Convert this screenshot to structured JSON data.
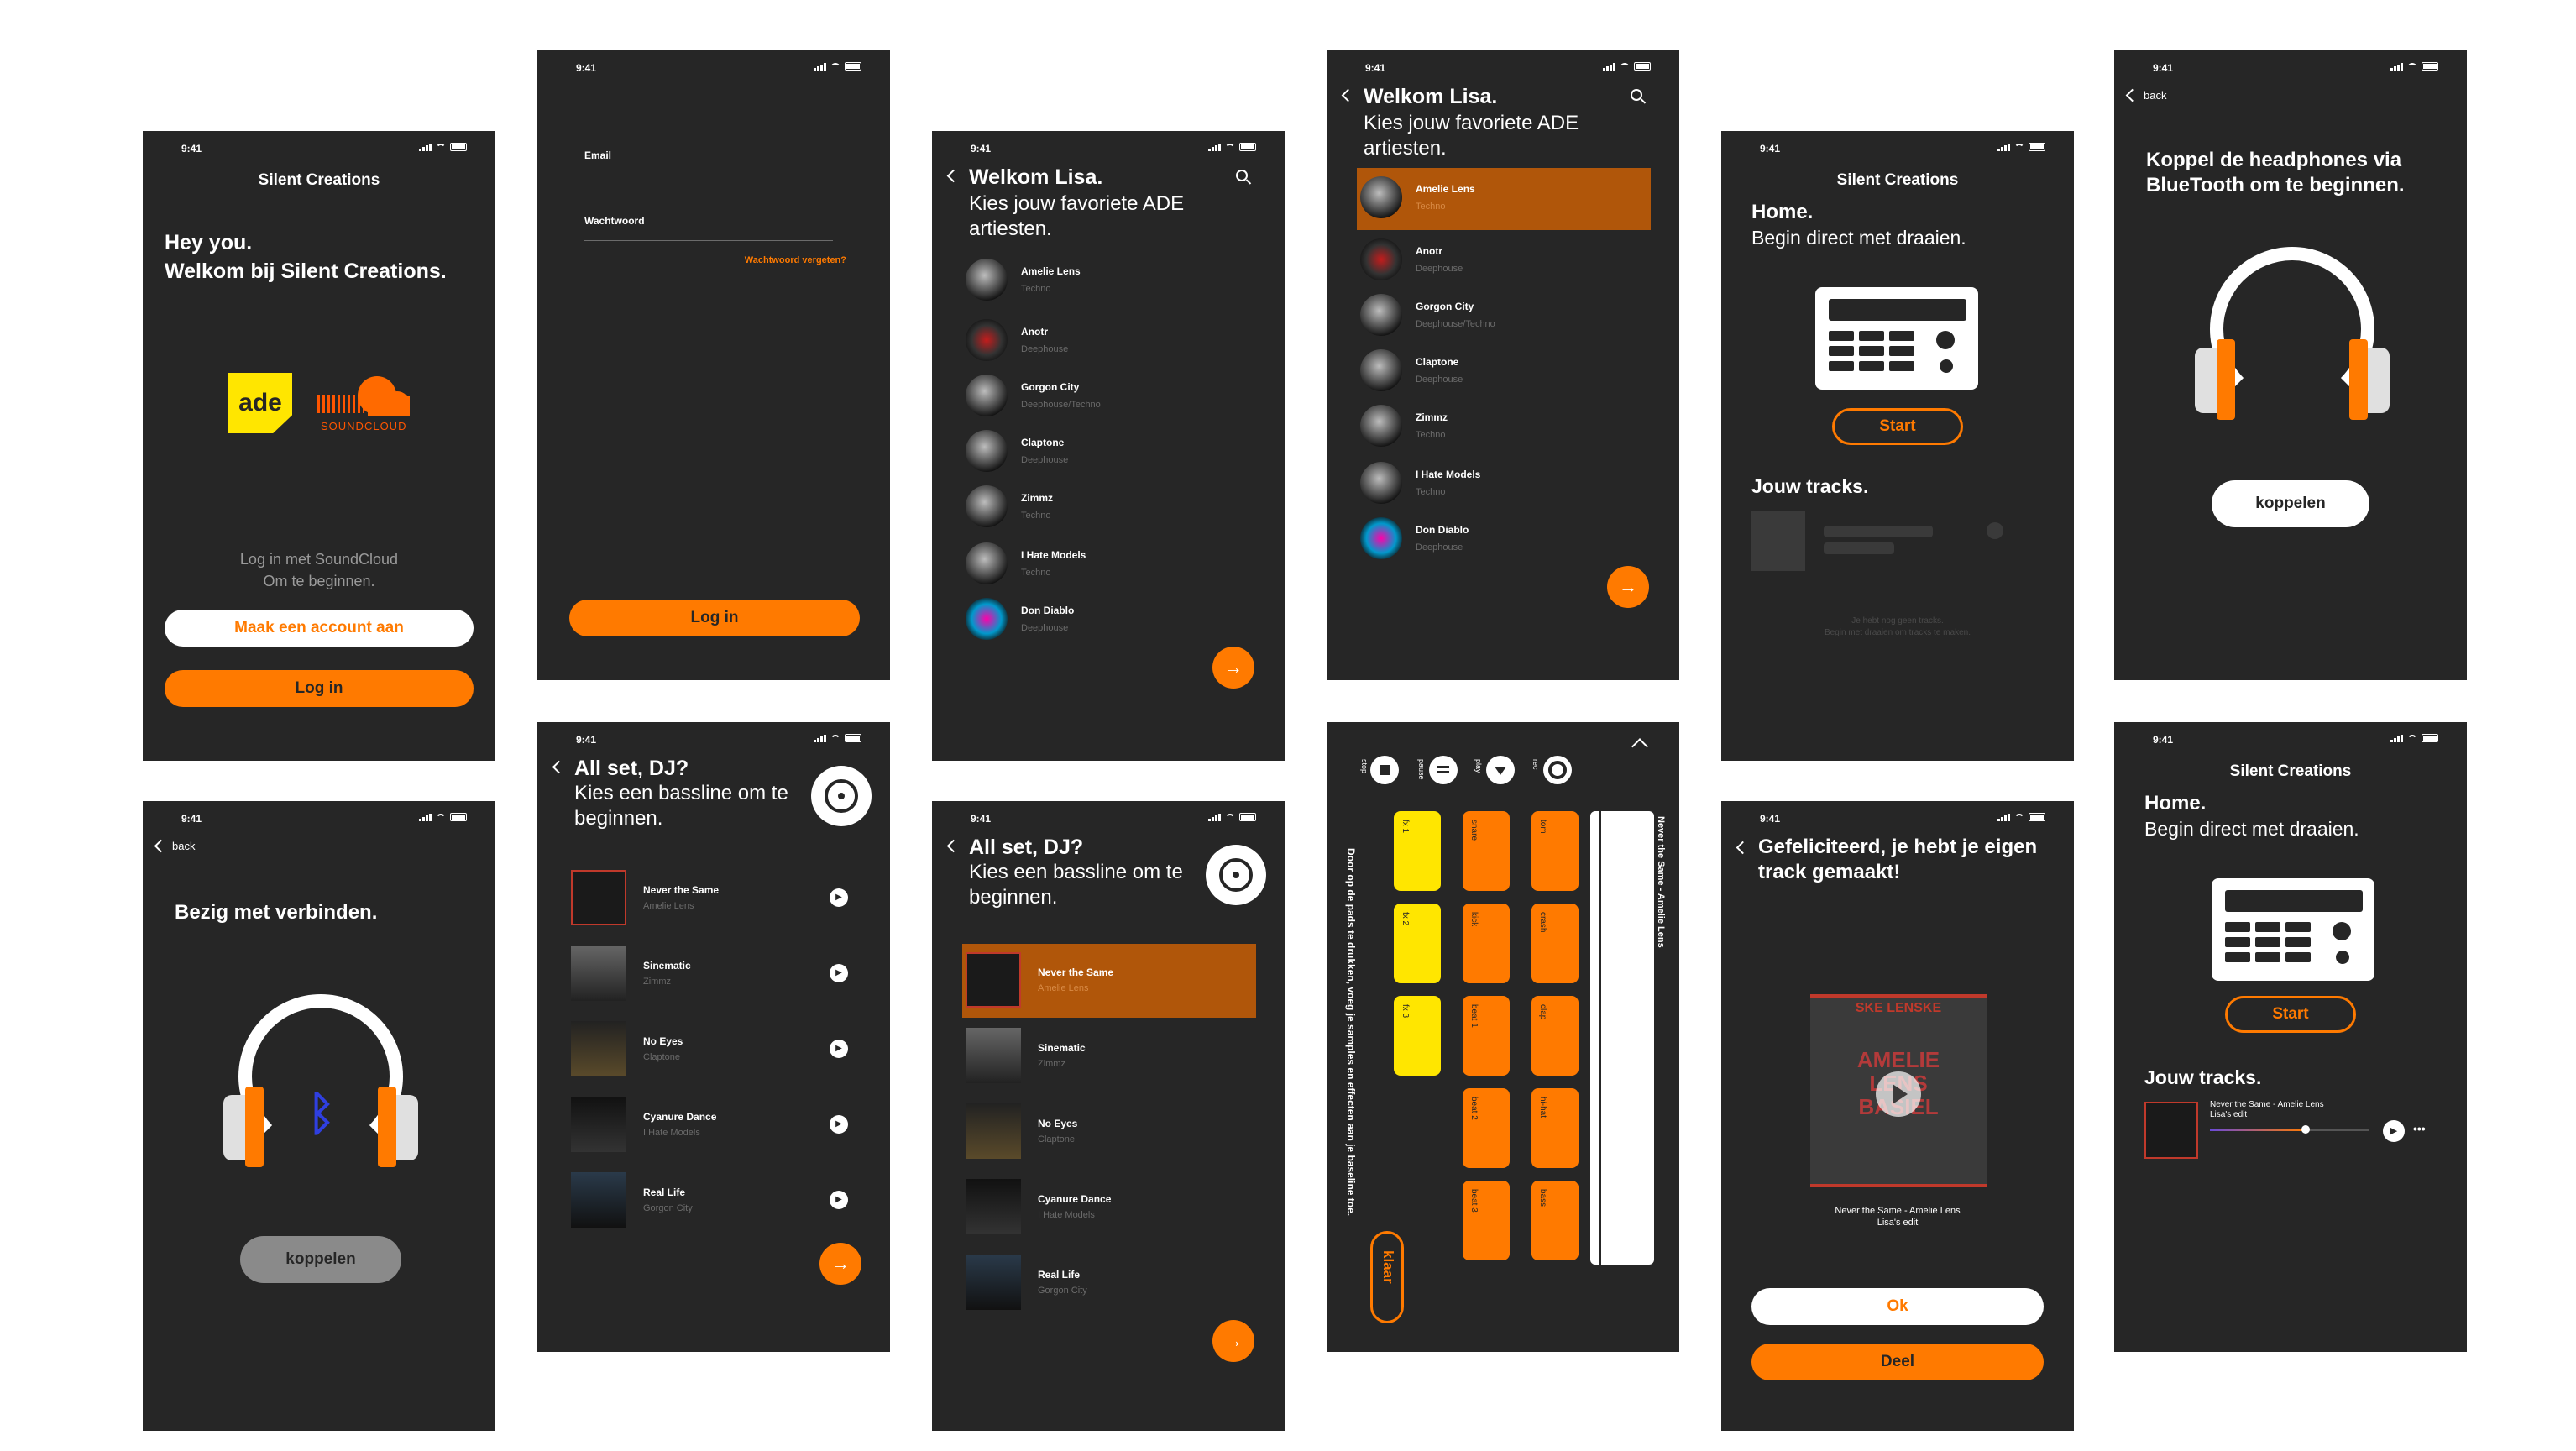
{
  "status_time": "9:41",
  "colors": {
    "accent": "#ff7a00",
    "screen_bg": "#262626",
    "pad_yellow": "#ffe600",
    "muted": "#6b6b6b"
  },
  "s1": {
    "app_title": "Silent Creations",
    "greeting": "Hey you.",
    "welcome": "Welkom bij Silent Creations.",
    "ade_logo": "ade",
    "soundcloud_logo": "SOUNDCLOUD",
    "login_hint_1": "Log in met SoundCloud",
    "login_hint_2": "Om te beginnen.",
    "create_account": "Maak een account aan",
    "login": "Log in"
  },
  "s2": {
    "email_label": "Email",
    "password_label": "Wachtwoord",
    "forgot": "Wachtwoord vergeten?",
    "login": "Log in"
  },
  "artists_screen": {
    "title": "Welkom Lisa.",
    "subtitle": "Kies jouw favoriete ADE artiesten.",
    "next_icon": "arrow-right-icon"
  },
  "artists": [
    {
      "name": "Amelie Lens",
      "genre": "Techno"
    },
    {
      "name": "Anotr",
      "genre": "Deephouse"
    },
    {
      "name": "Gorgon City",
      "genre": "Deephouse/Techno"
    },
    {
      "name": "Claptone",
      "genre": "Deephouse"
    },
    {
      "name": "Zimmz",
      "genre": "Techno"
    },
    {
      "name": "I Hate Models",
      "genre": "Techno"
    },
    {
      "name": "Don Diablo",
      "genre": "Deephouse"
    }
  ],
  "home": {
    "app_title": "Silent Creations",
    "title": "Home.",
    "subtitle": "Begin direct met draaien.",
    "start": "Start",
    "tracks_title": "Jouw tracks.",
    "empty_1": "Je hebt nog geen tracks.",
    "empty_2": "Begin met draaien om tracks te maken."
  },
  "pair": {
    "back": "back",
    "title": "Koppel de headphones via BlueTooth om te beginnen.",
    "button": "koppelen"
  },
  "connecting": {
    "back": "back",
    "title": "Bezig met verbinden.",
    "button": "koppelen"
  },
  "bassline": {
    "title": "All set, DJ?",
    "subtitle": "Kies een bassline om te beginnen."
  },
  "tracks": [
    {
      "name": "Never the Same",
      "artist": "Amelie Lens"
    },
    {
      "name": "Sinematic",
      "artist": "Zimmz"
    },
    {
      "name": "No Eyes",
      "artist": "Claptone"
    },
    {
      "name": "Cyanure Dance",
      "artist": "I Hate Models"
    },
    {
      "name": "Real Life",
      "artist": "Gorgon City"
    }
  ],
  "mixer": {
    "controls": [
      "stop",
      "pause",
      "play",
      "rec"
    ],
    "instruction": "Door op de pads te drukken, voeg je samples en effecten aan je baseline toe.",
    "done": "klaar",
    "now_playing": "Never the Same - Amelie Lens",
    "col1": [
      "fx 1",
      "fx 2",
      "fx 3"
    ],
    "col2": [
      "snare",
      "kick",
      "beat 1",
      "beat 2",
      "beat 3"
    ],
    "col3": [
      "tom",
      "crash",
      "clap",
      "hi-hat",
      "bass"
    ]
  },
  "congrats": {
    "title": "Gefeliciteerd, je hebt je eigen track gemaakt!",
    "cover_text_top": "SKE LENSKE",
    "cover_text_main": "AMELIE LENS BASIEL",
    "caption_1": "Never the Same - Amelie Lens",
    "caption_2": "Lisa's edit",
    "ok": "Ok",
    "share": "Deel"
  },
  "home2": {
    "app_title": "Silent Creations",
    "title": "Home.",
    "subtitle": "Begin direct met draaien.",
    "start": "Start",
    "tracks_title": "Jouw tracks.",
    "track_name": "Never the Same - Amelie Lens",
    "track_sub": "Lisa's edit",
    "progress": 0.6,
    "more": "•••"
  }
}
